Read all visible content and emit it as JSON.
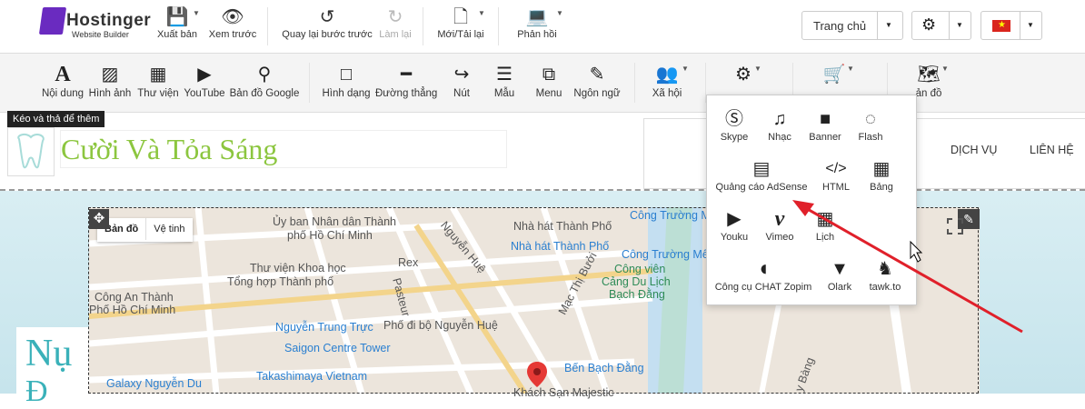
{
  "brand": {
    "name": "Hostinger",
    "sub": "Website Builder"
  },
  "top": {
    "export": "Xuất bản",
    "preview": "Xem trước",
    "undo": "Quay lại bước trước",
    "redo": "Làm lại",
    "newfile": "Mới/Tải lại",
    "version": "Phản hồi",
    "page_select": "Trang chủ"
  },
  "tools": [
    {
      "label": "Nội dung",
      "icon": "A"
    },
    {
      "label": "Hình ảnh",
      "icon": "▨"
    },
    {
      "label": "Thư viện",
      "icon": "▦"
    },
    {
      "label": "YouTube",
      "icon": "▶"
    },
    {
      "label": "Bản đồ Google",
      "icon": "⚲"
    },
    {
      "label": "Hình dạng",
      "icon": "□"
    },
    {
      "label": "Đường thẳng",
      "icon": "━"
    },
    {
      "label": "Nút",
      "icon": "↪"
    },
    {
      "label": "Mẫu",
      "icon": "☰"
    },
    {
      "label": "Menu",
      "icon": "⧉"
    },
    {
      "label": "Ngôn ngữ",
      "icon": "✎"
    },
    {
      "label": "Xã hội",
      "icon": "👥"
    },
    {
      "label": "",
      "icon": "⚙"
    },
    {
      "label": "",
      "icon": "🛒"
    },
    {
      "label": "ản đồ",
      "icon": "🗺"
    }
  ],
  "tooltip": "Kéo và thả để thêm",
  "site": {
    "tagline": "Cười Và Tỏa Sáng",
    "nav": [
      "DỊCH VỤ",
      "LIÊN HỆ"
    ],
    "hero_big": "Nụ",
    "hero_big2": "Đ"
  },
  "map": {
    "toggle": [
      "Bản đồ",
      "Vệ tinh"
    ],
    "labels": [
      {
        "t": "Ủy ban Nhân dân Thành",
        "c": ""
      },
      {
        "t": "phố Hồ Chí Minh",
        "c": ""
      },
      {
        "t": "Nhà hát Thành Phố",
        "c": ""
      },
      {
        "t": "Nhà hát Thành Phố",
        "c": "blue"
      },
      {
        "t": "Công Trường Mê",
        "c": "blue"
      },
      {
        "t": "Công Trường Mê Li",
        "c": "blue"
      },
      {
        "t": "Công viên",
        "c": "green"
      },
      {
        "t": "Cảng Du Lịch",
        "c": "green"
      },
      {
        "t": "Bạch Đằng",
        "c": "green"
      },
      {
        "t": "Thư viện Khoa học",
        "c": ""
      },
      {
        "t": "Tổng hợp Thành phố",
        "c": ""
      },
      {
        "t": "Rex",
        "c": ""
      },
      {
        "t": "Nguyễn Huệ",
        "c": ""
      },
      {
        "t": "Pasteur",
        "c": ""
      },
      {
        "t": "Mạc Thị Bưởi",
        "c": ""
      },
      {
        "t": "Công An Thành",
        "c": ""
      },
      {
        "t": "Phố Hồ Chí Minh",
        "c": ""
      },
      {
        "t": "Nguyễn Trung Trực",
        "c": "blue"
      },
      {
        "t": "Phố đi bộ Nguyễn Huệ",
        "c": ""
      },
      {
        "t": "Saigon Centre Tower",
        "c": "blue"
      },
      {
        "t": "Takashimaya Vietnam",
        "c": "blue"
      },
      {
        "t": "Bến Bạch Đằng",
        "c": "blue"
      },
      {
        "t": "Galaxy Nguyễn Du",
        "c": "blue"
      },
      {
        "t": "Khách Sạn Majestic",
        "c": ""
      },
      {
        "t": "y Bàng",
        "c": ""
      }
    ]
  },
  "dropdown": [
    {
      "label": "Skype",
      "icon": "Ⓢ"
    },
    {
      "label": "Nhạc",
      "icon": "♫"
    },
    {
      "label": "Banner",
      "icon": "■"
    },
    {
      "label": "Flash",
      "icon": "◌"
    },
    {
      "label": "Quảng cáo AdSense",
      "icon": "▤"
    },
    {
      "label": "HTML",
      "icon": "</>"
    },
    {
      "label": "Bảng",
      "icon": "▦"
    },
    {
      "label": "Youku",
      "icon": "▶"
    },
    {
      "label": "Vimeo",
      "icon": "v"
    },
    {
      "label": "Lịch",
      "icon": "▦"
    },
    {
      "label": "Công cụ CHAT Zopim",
      "icon": "◖"
    },
    {
      "label": "Olark",
      "icon": "▼"
    },
    {
      "label": "tawk.to",
      "icon": "♞"
    }
  ],
  "colors": {
    "brand": "#6a2bc0",
    "tagline": "#8cc63f",
    "teal": "#3ab1b9",
    "arrow": "#e0202a"
  }
}
